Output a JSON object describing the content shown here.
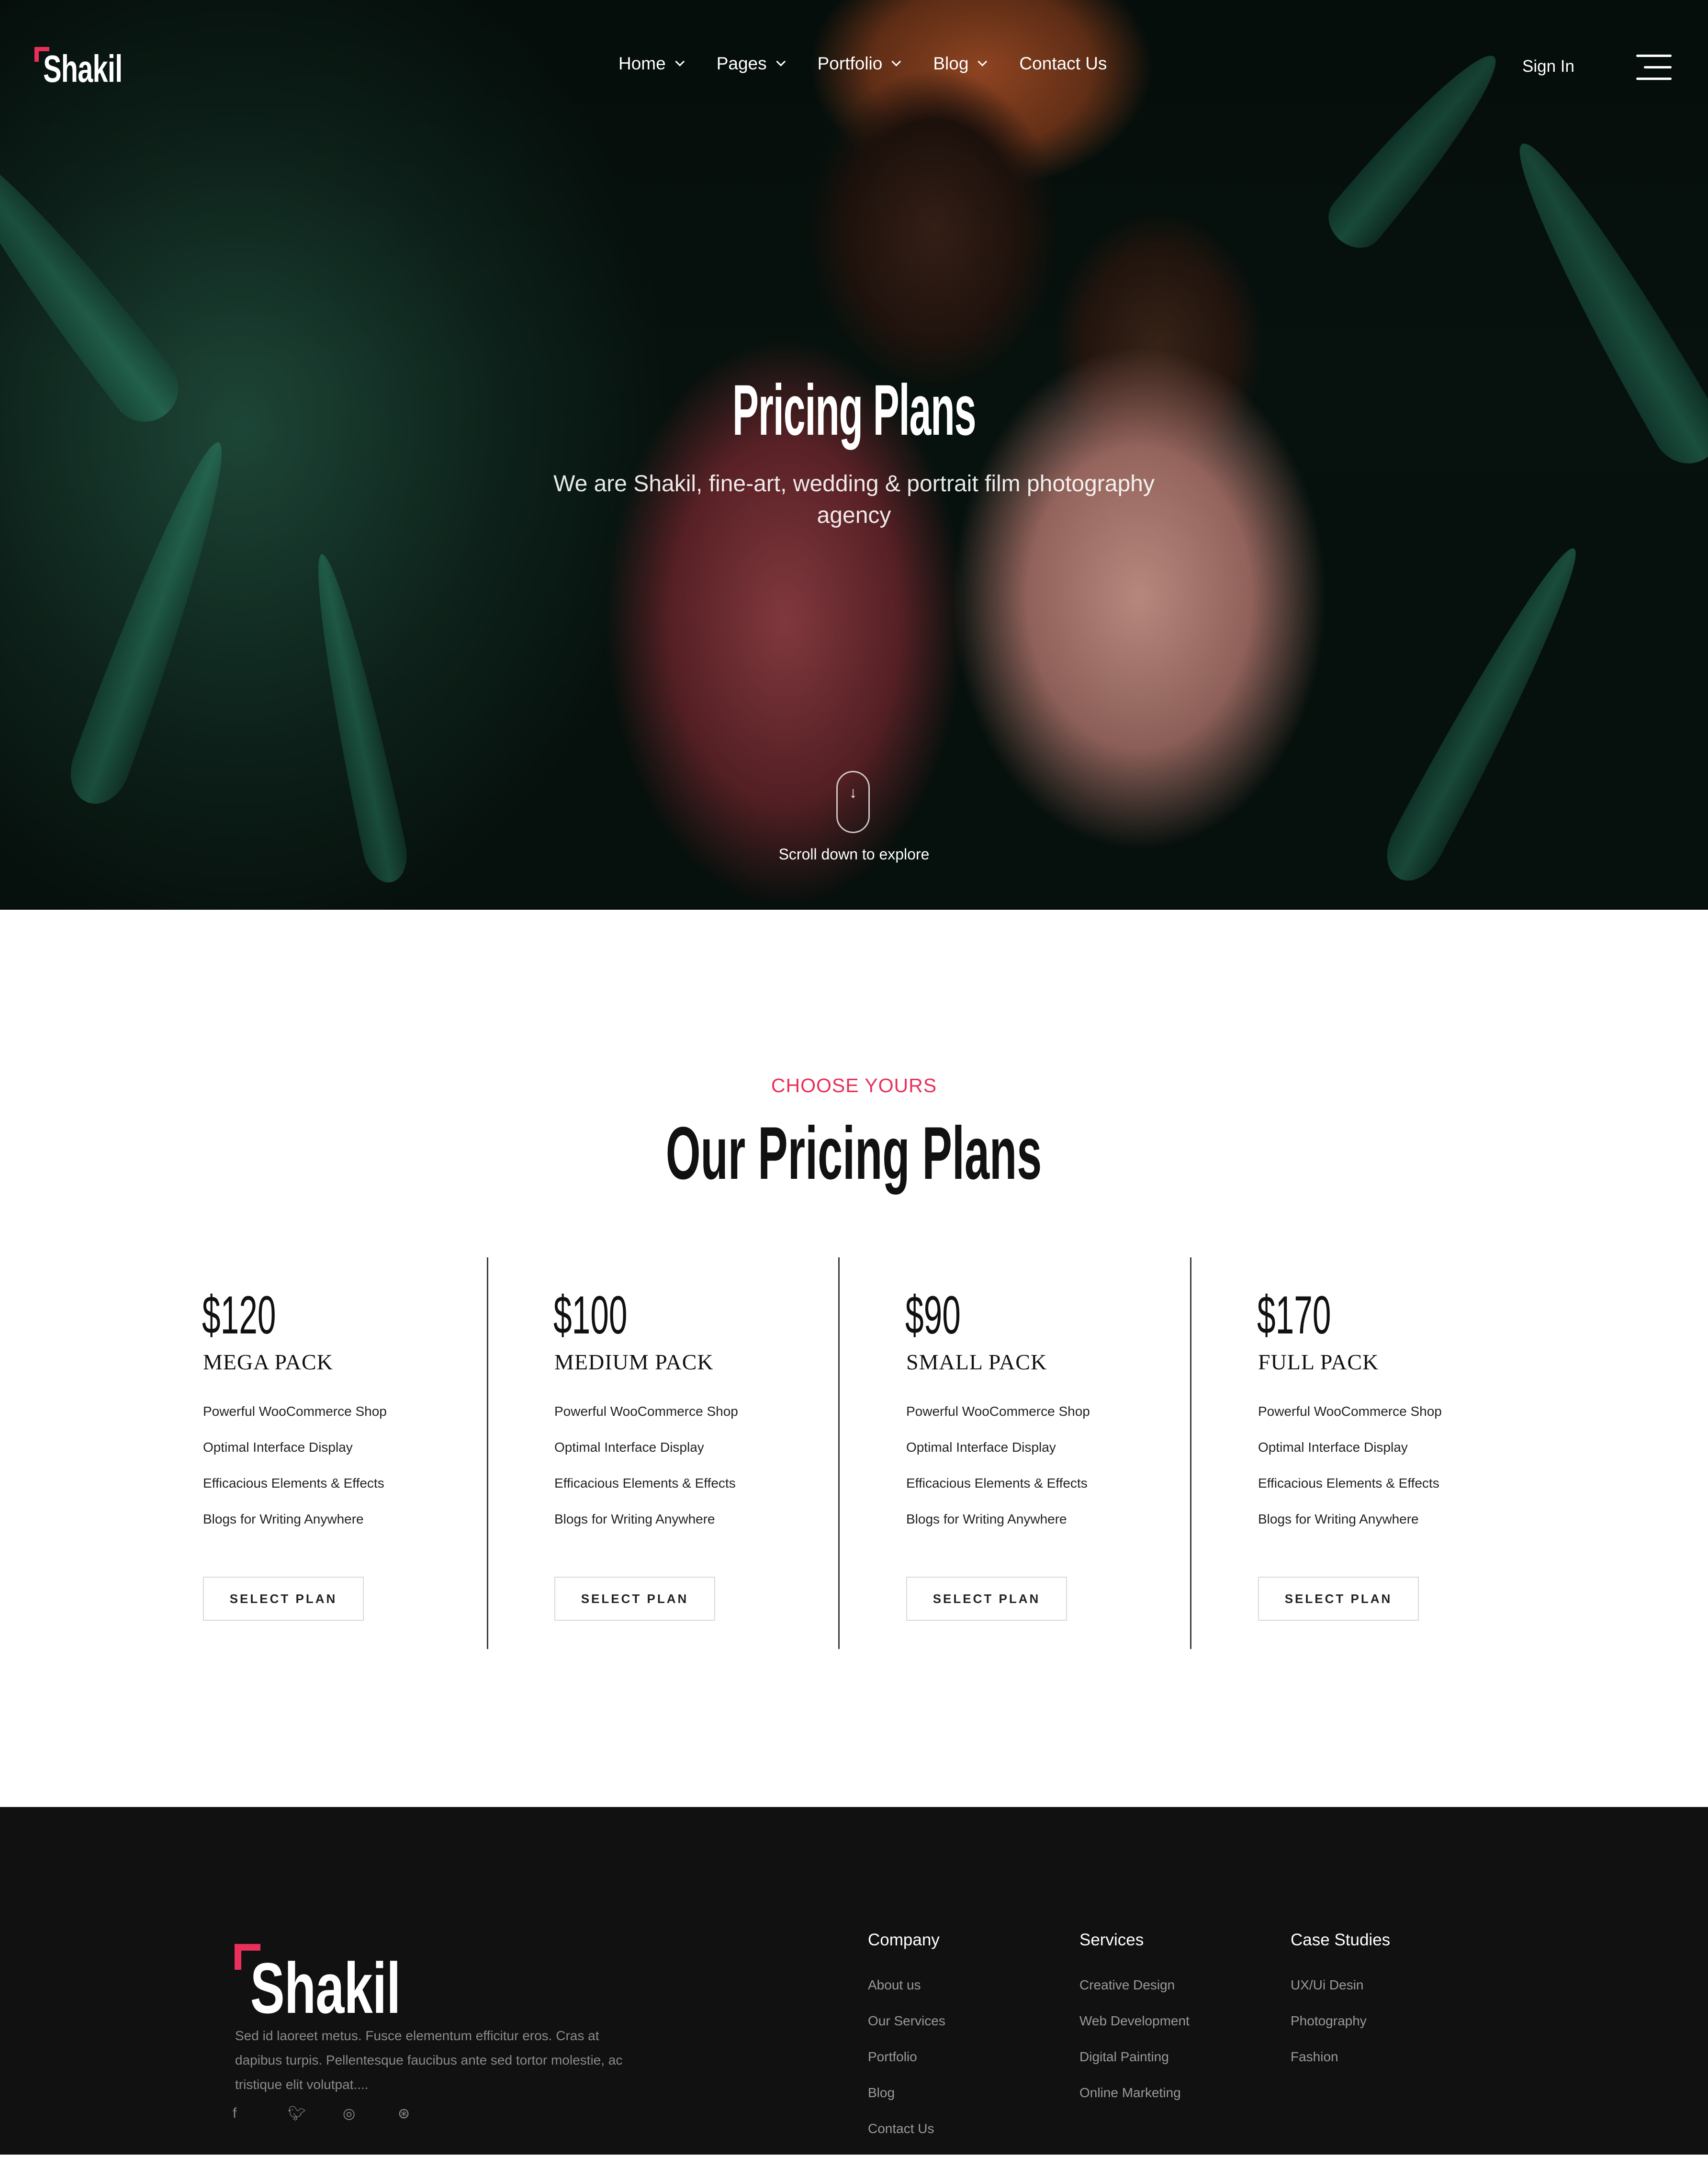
{
  "header": {
    "logo_text": "Shakil",
    "nav": [
      {
        "label": "Home",
        "has_dropdown": true
      },
      {
        "label": "Pages",
        "has_dropdown": true
      },
      {
        "label": "Portfolio",
        "has_dropdown": true
      },
      {
        "label": "Blog",
        "has_dropdown": true
      },
      {
        "label": "Contact Us",
        "has_dropdown": false
      }
    ],
    "signin_label": "Sign In",
    "menu_icon": "hamburger-icon"
  },
  "hero": {
    "title": "Pricing Plans",
    "subtitle": "We are Shakil, fine-art, wedding & portrait film photography agency",
    "scroll_label": "Scroll down to explore",
    "scroll_icon": "arrow-down-icon"
  },
  "pricing": {
    "eyebrow": "CHOOSE YOURS",
    "title": "Our Pricing Plans",
    "plans": [
      {
        "price": "$120",
        "name": "MEGA PACK",
        "features": [
          "Powerful WooCommerce Shop",
          "Optimal Interface Display",
          "Efficacious Elements & Effects",
          "Blogs for Writing Anywhere"
        ],
        "button": "SELECT PLAN"
      },
      {
        "price": "$100",
        "name": "MEDIUM PACK",
        "features": [
          "Powerful WooCommerce Shop",
          "Optimal Interface Display",
          "Efficacious Elements & Effects",
          "Blogs for Writing Anywhere"
        ],
        "button": "SELECT PLAN"
      },
      {
        "price": "$90",
        "name": "SMALL PACK",
        "features": [
          "Powerful WooCommerce Shop",
          "Optimal Interface Display",
          "Efficacious Elements & Effects",
          "Blogs for Writing Anywhere"
        ],
        "button": "SELECT PLAN"
      },
      {
        "price": "$170",
        "name": "FULL PACK",
        "features": [
          "Powerful WooCommerce Shop",
          "Optimal Interface Display",
          "Efficacious Elements & Effects",
          "Blogs for Writing Anywhere"
        ],
        "button": "SELECT PLAN"
      }
    ]
  },
  "footer": {
    "logo_text": "Shakil",
    "description": "Sed id laoreet metus. Fusce elementum efficitur eros. Cras at dapibus turpis. Pellentesque faucibus ante sed tortor molestie, ac tristique elit volutpat....",
    "socials": [
      "facebook-icon",
      "twitter-icon",
      "instagram-icon",
      "dribbble-icon"
    ],
    "columns": [
      {
        "heading": "Company",
        "links": [
          "About us",
          "Our Services",
          "Portfolio",
          "Blog",
          "Contact Us"
        ]
      },
      {
        "heading": "Services",
        "links": [
          "Creative Design",
          "Web Development",
          "Digital Painting",
          "Online Marketing"
        ]
      },
      {
        "heading": "Case Studies",
        "links": [
          "UX/Ui Desin",
          "Photography",
          "Fashion"
        ]
      }
    ]
  },
  "colors": {
    "accent": "#e8305a",
    "footer_bg": "#111111",
    "text_dark": "#111111"
  }
}
